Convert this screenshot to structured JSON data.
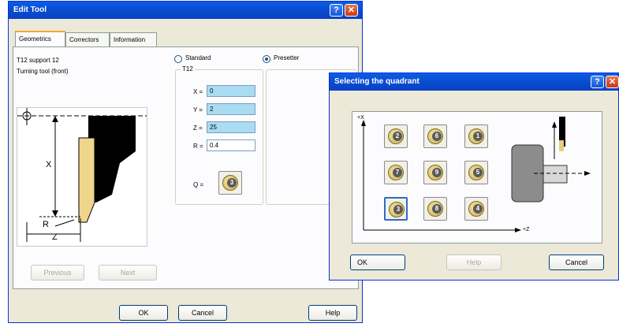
{
  "edit_tool": {
    "title": "Edit Tool",
    "tabs": [
      "Geometrics",
      "Correctors",
      "Information"
    ],
    "tool_name": "T12 support 12",
    "tool_type": "Turning tool (front)",
    "radio_standard": "Standard",
    "radio_presetter": "Presetter",
    "group_label": "T12",
    "fields": {
      "x_label": "X =",
      "x_value": "0",
      "y_label": "Y =",
      "y_value": "2",
      "z_label": "Z =",
      "z_value": "25",
      "r_label": "R =",
      "r_value": "0.4",
      "q_label": "Q =",
      "q_value": "3"
    },
    "diagram_labels": {
      "x": "X",
      "z": "Z",
      "r": "R"
    },
    "previous_button": "Previous",
    "next_button": "Next",
    "ok_button": "OK",
    "cancel_button": "Cancel",
    "help_button": "Help"
  },
  "quadrant_dialog": {
    "title": "Selecting the quadrant",
    "axis_x": "+X",
    "axis_z": "+Z",
    "quadrants": [
      "2",
      "6",
      "1",
      "7",
      "9",
      "5",
      "3",
      "8",
      "4"
    ],
    "ok_button": "OK",
    "help_button": "Help",
    "cancel_button": "Cancel"
  },
  "colors": {
    "titlebar": "#0b4fd2",
    "field_highlight": "#a8dcf3",
    "window_bg": "#ece9d8"
  }
}
